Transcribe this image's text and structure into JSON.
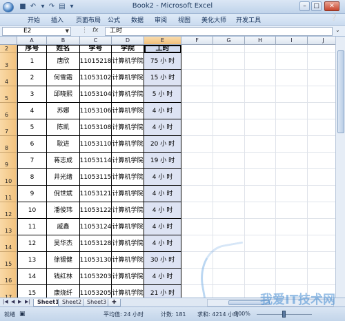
{
  "window": {
    "title": "Book2 - Microsoft Excel"
  },
  "quick_access": {
    "save_icon": "save-icon",
    "undo_icon": "undo-icon",
    "redo_icon": "redo-icon"
  },
  "ribbon_tabs": [
    "开始",
    "插入",
    "页面布局",
    "公式",
    "数据",
    "审阅",
    "视图",
    "美化大师",
    "开发工具"
  ],
  "formula_bar": {
    "name_box": "E2",
    "fx_label": "fx",
    "content": "工时"
  },
  "columns": [
    "A",
    "B",
    "C",
    "D",
    "E",
    "F",
    "G",
    "H",
    "I",
    "J"
  ],
  "selected_column": "E",
  "header_row": {
    "row_number": "2",
    "cells": [
      "序号",
      "姓名",
      "学号",
      "学院",
      "工时"
    ]
  },
  "rows": [
    {
      "row": "3",
      "cells": [
        "1",
        "唐欣",
        "11015218",
        "计算机学院",
        "75 小 时"
      ]
    },
    {
      "row": "4",
      "cells": [
        "2",
        "何雪霜",
        "11053102",
        "计算机学院",
        "15 小 时"
      ]
    },
    {
      "row": "5",
      "cells": [
        "3",
        "邱晓熙",
        "11053104",
        "计算机学院",
        "5 小 时"
      ]
    },
    {
      "row": "6",
      "cells": [
        "4",
        "苏娜",
        "11053106",
        "计算机学院",
        "4 小 时"
      ]
    },
    {
      "row": "7",
      "cells": [
        "5",
        "陈凯",
        "11053108",
        "计算机学院",
        "4 小 时"
      ]
    },
    {
      "row": "8",
      "cells": [
        "6",
        "耿进",
        "11053110",
        "计算机学院",
        "20 小 时"
      ]
    },
    {
      "row": "9",
      "cells": [
        "7",
        "蒋志成",
        "11053114",
        "计算机学院",
        "19 小 时"
      ]
    },
    {
      "row": "10",
      "cells": [
        "8",
        "井光绪",
        "11053115",
        "计算机学院",
        "4 小 时"
      ]
    },
    {
      "row": "11",
      "cells": [
        "9",
        "倪世斌",
        "11053121",
        "计算机学院",
        "4 小 时"
      ]
    },
    {
      "row": "12",
      "cells": [
        "10",
        "潘俊玮",
        "11053122",
        "计算机学院",
        "4 小 时"
      ]
    },
    {
      "row": "13",
      "cells": [
        "11",
        "戚鑫",
        "11053124",
        "计算机学院",
        "4 小 时"
      ]
    },
    {
      "row": "14",
      "cells": [
        "12",
        "吴华杰",
        "11053128",
        "计算机学院",
        "4 小 时"
      ]
    },
    {
      "row": "15",
      "cells": [
        "13",
        "徐锡健",
        "11053130",
        "计算机学院",
        "30 小 时"
      ]
    },
    {
      "row": "16",
      "cells": [
        "14",
        "钱红林",
        "11053203",
        "计算机学院",
        "4 小 时"
      ]
    },
    {
      "row": "17",
      "cells": [
        "15",
        "康烧纤",
        "11053205",
        "计算机学院",
        "21 小 时"
      ]
    }
  ],
  "sheet_tabs": [
    "Sheet1",
    "Sheet2",
    "Sheet3"
  ],
  "active_sheet": "Sheet1",
  "status": {
    "mode": "就绪",
    "average": "平均值: 24 小时",
    "count": "计数: 181",
    "sum": "求和: 4214 小时",
    "zoom": "100%"
  },
  "watermark": "我爱IT技术网"
}
